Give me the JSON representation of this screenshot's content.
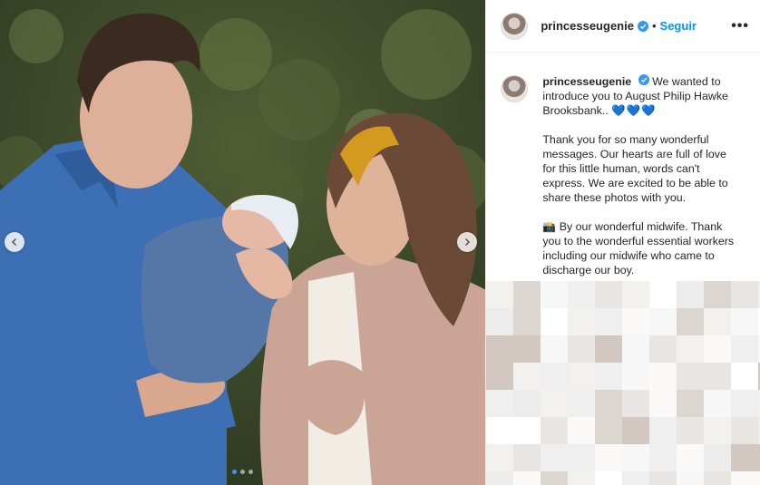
{
  "post": {
    "username": "princesseugenie",
    "follow_label": "Seguir",
    "separator": "•",
    "more_label": "•••",
    "caption": {
      "line1": "We wanted to introduce you to August Philip Hawke Brooksbank..",
      "hearts": "💙💙💙",
      "paragraph2": "Thank you for so many wonderful messages. Our hearts are full of love for this little human, words can't express. We are excited to be able to share these photos with you.",
      "camera_emoji": "📸",
      "paragraph3": "By our wonderful midwife. Thank you to the wonderful essential workers including our midwife who came to discharge our boy."
    }
  },
  "colors": {
    "accent": "#0095f6",
    "verified": "#3897f0",
    "active_dot": "#3f95f6"
  },
  "icons": [
    "verified-badge-icon",
    "chevron-left-icon",
    "chevron-right-icon",
    "more-options-icon"
  ]
}
